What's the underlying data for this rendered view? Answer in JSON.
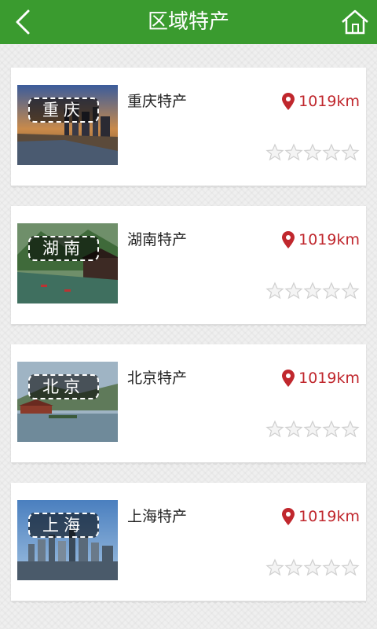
{
  "header": {
    "title": "区域特产",
    "back_icon": "back-icon",
    "home_icon": "home-icon"
  },
  "items": [
    {
      "thumb_label": "重庆",
      "name": "重庆特产",
      "distance": "1019km",
      "rating": 0
    },
    {
      "thumb_label": "湖南",
      "name": "湖南特产",
      "distance": "1019km",
      "rating": 0
    },
    {
      "thumb_label": "北京",
      "name": "北京特产",
      "distance": "1019km",
      "rating": 0
    },
    {
      "thumb_label": "上海",
      "name": "上海特产",
      "distance": "1019km",
      "rating": 0
    }
  ],
  "colors": {
    "header": "#3a9b2f",
    "distance": "#c0272d"
  }
}
